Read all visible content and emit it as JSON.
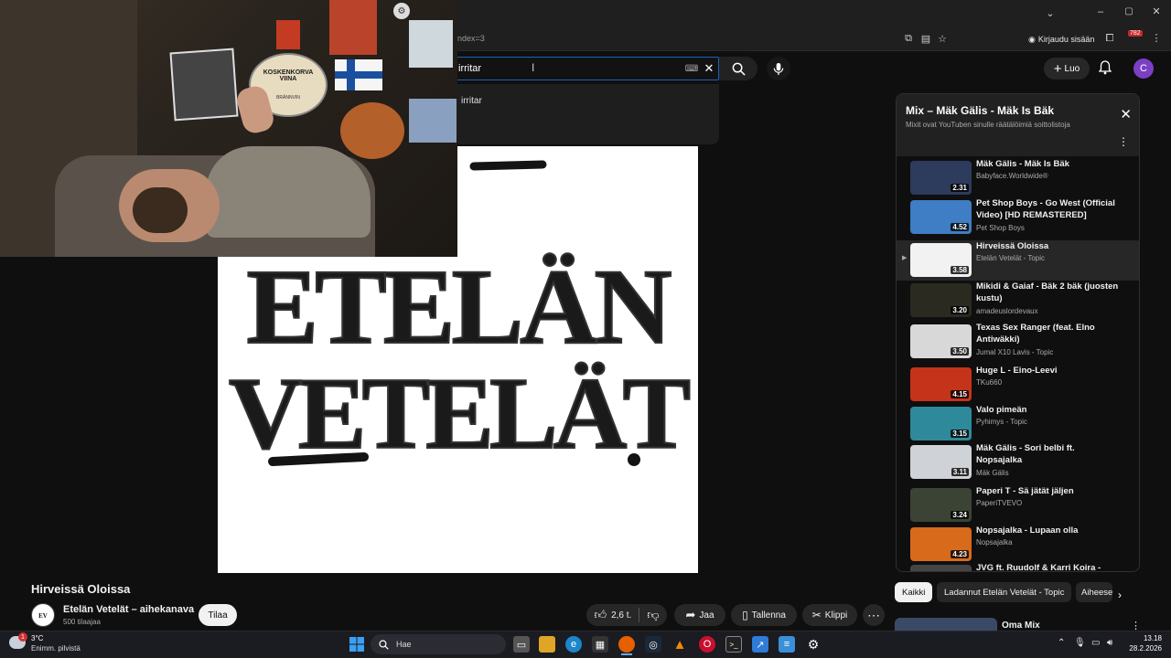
{
  "browser": {
    "url_fragment": "index=3",
    "signin_label": "Kirjaudu sisään",
    "badge_count": "782"
  },
  "header": {
    "search_value": "irritar",
    "create_label": "Luo",
    "avatar_letter": "C"
  },
  "suggestion": {
    "text": "irritar"
  },
  "video": {
    "title": "Hirveissä Oloissa",
    "channel_name": "Etelän Vetelät – aihekanava",
    "subscribers": "500 tilaajaa",
    "subscribe_label": "Tilaa",
    "like_count": "2,6 t.",
    "share_label": "Jaa",
    "save_label": "Tallenna",
    "clip_label": "Klippi",
    "art_line1": "ETELÄN",
    "art_line2": "VETELÄT"
  },
  "webcam": {
    "sign_line1": "KOSKENKORVA",
    "sign_line2": "VIINA",
    "sign_line3": "BRÄNNVIN"
  },
  "playlist": {
    "title": "Mix – Mäk Gälis - Mäk Is Bäk",
    "subtitle": "Mixit ovat YouTuben sinulle räätälöimiä soittolistoja",
    "items": [
      {
        "title": "Mäk Gälis - Mäk Is Bäk",
        "channel": "Babyface.Worldwide®",
        "duration": "2.31",
        "color": "#2d3b5c"
      },
      {
        "title": "Pet Shop Boys - Go West (Official Video) [HD REMASTERED]",
        "channel": "Pet Shop Boys",
        "duration": "4.52",
        "color": "#3f7dc4"
      },
      {
        "title": "Hirveissä Oloissa",
        "channel": "Etelän Vetelät - Topic",
        "duration": "3.58",
        "color": "#f2f2f2"
      },
      {
        "title": "Mikidi & Gaiaf - Bäk 2 bäk (juosten kustu)",
        "channel": "amadeuslordevaux",
        "duration": "3.20",
        "color": "#2a2a20"
      },
      {
        "title": "Texas Sex Ranger (feat. Elno Antiwäkki)",
        "channel": "Jumal X10 Lavis - Topic",
        "duration": "3.50",
        "color": "#d8d8d8"
      },
      {
        "title": "Huge L - Eino-Leevi",
        "channel": "TKu660",
        "duration": "4.15",
        "color": "#c5331a"
      },
      {
        "title": "Valo pimeän",
        "channel": "Pyhimys - Topic",
        "duration": "3.15",
        "color": "#2e8a9a"
      },
      {
        "title": "Mäk Gälis - Sori belbi ft. Nopsajalka",
        "channel": "Mäk Gälis",
        "duration": "3.11",
        "color": "#cfd3d8"
      },
      {
        "title": "Paperi T - Sä jätät jäljen",
        "channel": "PaperiTVEVO",
        "duration": "3.24",
        "color": "#3b4434"
      },
      {
        "title": "Nopsajalka - Lupaan olla",
        "channel": "Nopsajalka",
        "duration": "4.23",
        "color": "#d86a1c"
      },
      {
        "title": "JVG ft. Ruudolf & Karri Koira -",
        "channel": "",
        "duration": "",
        "color": "#444"
      }
    ]
  },
  "chips": [
    "Kaikki",
    "Ladannut Etelän Vetelät - Topic",
    "Aiheeseen liittyvät"
  ],
  "next_up": {
    "title": "Oma Mix"
  },
  "taskbar": {
    "weather_temp": "3°C",
    "weather_desc": "Enimm. pilvistä",
    "search_label": "Hae",
    "time": "13.18",
    "date": "28.2.2026",
    "notif_count": "1"
  },
  "colors": {
    "accent_blue": "#1c62b9",
    "avatar_purple": "#7b3fc4",
    "brand_red": "#ff0000"
  }
}
